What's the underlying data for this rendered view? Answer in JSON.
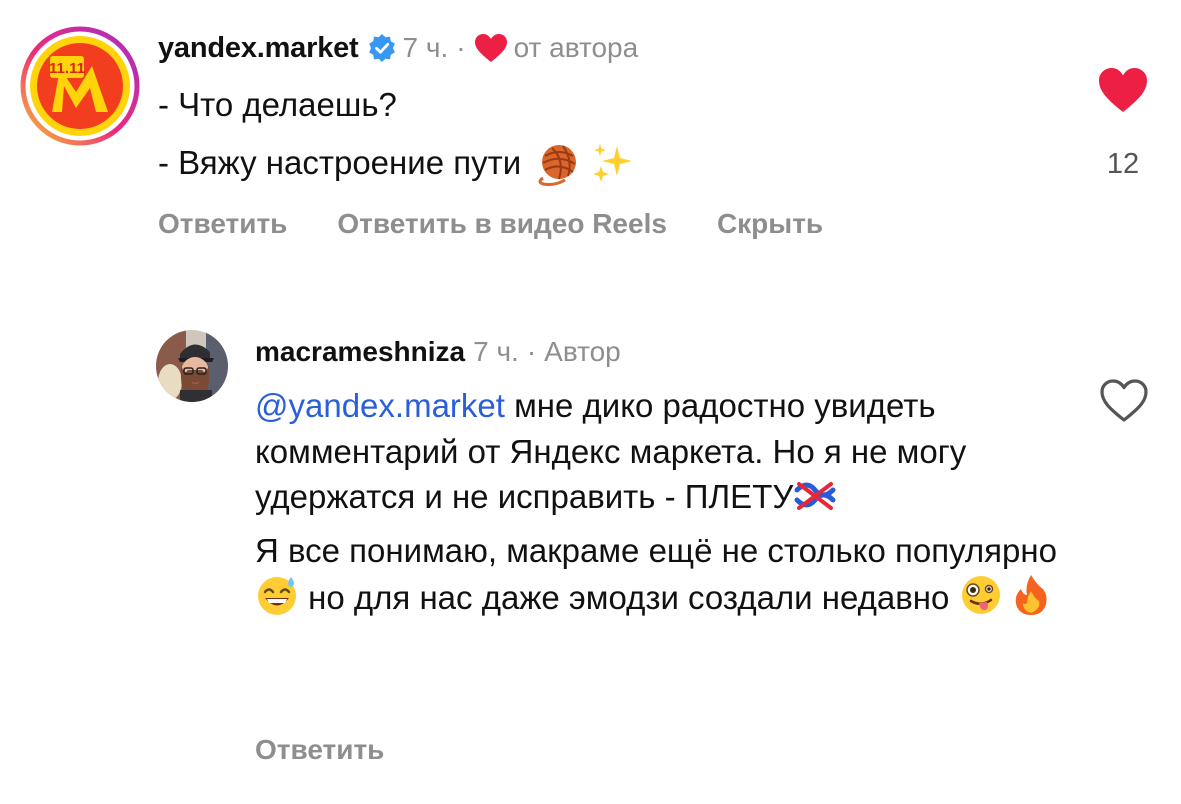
{
  "comment1": {
    "username": "yandex.market",
    "avatar_text": "11.11",
    "verified_icon": "verified-badge-icon",
    "time": "7 ч.",
    "separator": "·",
    "author_liked_label": "от автора",
    "line1": "- Что делаешь?",
    "line2": "- Вяжу настроение пути",
    "emojis": [
      "yarn-ball-emoji",
      "sparkles-emoji"
    ],
    "actions": {
      "reply": "Ответить",
      "reply_reels": "Ответить в видео Reels",
      "hide": "Скрыть"
    },
    "likes": "12",
    "like_color": "#ed1f45"
  },
  "comment2": {
    "username": "macrameshniza",
    "time": "7 ч.",
    "separator": "·",
    "role": "Автор",
    "mention": "@yandex.market",
    "para1_text": " мне дико радостно увидеть комментарий от Яндекс маркета. Но я не могу удержатся и не исправить - ПЛЕТУ",
    "para2_a": "Я все понимаю, макраме ещё не столько популярно ",
    "para2_b": " но для нас даже эмодзи создали недавно ",
    "emojis": [
      "knot-crossed-emoji",
      "sweat-smile-emoji",
      "zany-face-emoji",
      "fire-emoji"
    ],
    "reply": "Ответить",
    "mention_color": "#2b5fd9"
  }
}
